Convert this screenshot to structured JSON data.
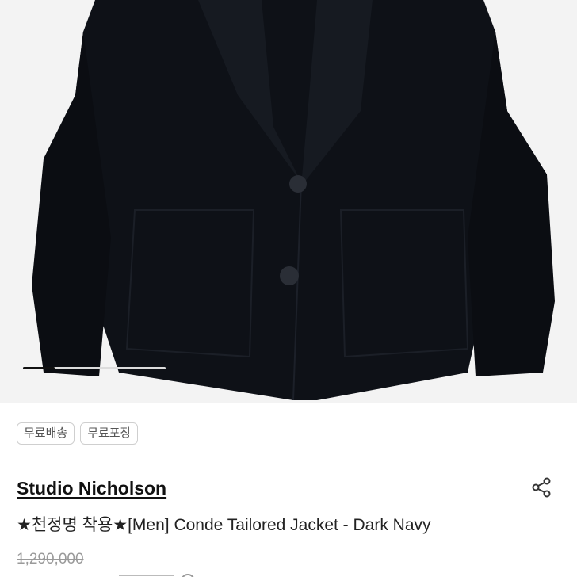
{
  "gallery": {
    "image_alt": "Dark navy tailored jacket",
    "progress": 0.22
  },
  "tags": [
    "무료배송",
    "무료포장"
  ],
  "product": {
    "brand": "Studio Nicholson",
    "title": "★천정명 착용★[Men] Conde Tailored Jacket - Dark Navy",
    "original_price": "1,290,000"
  },
  "icons": {
    "share": "share-icon"
  },
  "colors": {
    "jacket": "#0e1117",
    "background": "#f3f3f3",
    "text": "#111111",
    "muted": "#9a9a9a"
  }
}
